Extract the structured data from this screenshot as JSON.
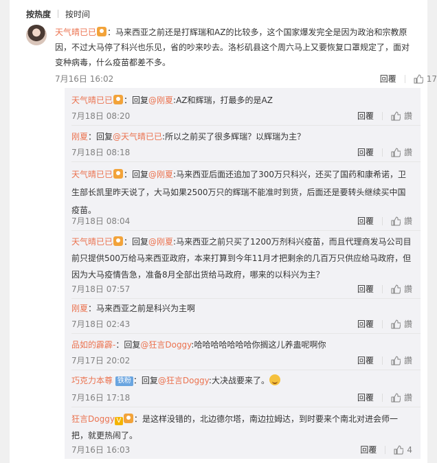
{
  "sort": {
    "hot": "按热度",
    "time": "按时间"
  },
  "main": {
    "user": "天气晴已已",
    "text": "：马来西亚之前还是打辉瑞和AZ的比较多，这个国家爆发完全是因为政治和宗教原因，不过大马停了科兴也乐见，省的吵来吵去。洛杉矶县这个周六马上又要恢复口罩规定了，面对变种病毒，什么疫苗都差不多。",
    "date": "7月16日 16:02",
    "reply": "回覆",
    "likes": "17"
  },
  "replies": [
    {
      "user": "天气晴已已",
      "badge": true,
      "prefix": "：回复",
      "mention": "@刚夏",
      "text": ":AZ和辉瑞，打最多的是AZ",
      "date": "7月18日 08:20",
      "reply": "回覆",
      "like": "讚"
    },
    {
      "user": "刚夏",
      "prefix": "：回复",
      "mention": "@天气晴已已",
      "text": ":所以之前买了很多辉瑞？以辉瑞为主？",
      "date": "7月18日 08:18",
      "reply": "回覆",
      "like": "讚"
    },
    {
      "user": "天气晴已已",
      "badge": true,
      "prefix": "：回复",
      "mention": "@刚夏",
      "text": ":马来西亚后面还追加了300万只科兴，还买了国药和康希诺，卫生部长凯里昨天说了，大马如果2500万只的辉瑞不能准时到货，后面还是要转头继续买中国疫苗。",
      "date": "7月18日 08:04",
      "reply": "回覆",
      "like": "讚"
    },
    {
      "user": "天气晴已已",
      "badge": true,
      "prefix": "：回复",
      "mention": "@刚夏",
      "text": ":马来西亚之前只买了1200万剂科兴疫苗，而且代理商发马公司目前只提供500万给马来西亚政府，本来打算到今年11月才把剩余的几百万只供应给马政府，但因为大马疫情告急，准备8月全部出货给马政府，哪来的以科兴为主？",
      "date": "7月18日 07:57",
      "reply": "回覆",
      "like": "讚"
    },
    {
      "user": "刚夏",
      "prefix": "：",
      "mention": "",
      "text": "马来西亚之前是科兴为主啊",
      "date": "7月18日 02:43",
      "reply": "回覆",
      "like": "讚"
    },
    {
      "user": "品如的霹霹-",
      "prefix": "：回复",
      "mention": "@狂言Doggy",
      "text": ":哈哈哈哈哈哈哈你搁这儿养蛊呢啊你",
      "date": "7月17日 20:02",
      "reply": "回覆",
      "like": "讚"
    },
    {
      "user": "巧克力本尊",
      "tag": "铁粉",
      "prefix": "：回复",
      "mention": "@狂言Doggy",
      "text": ":大决战要来了。",
      "emoji": true,
      "date": "7月16日 17:18",
      "reply": "回覆",
      "like": "讚"
    },
    {
      "user": "狂言Doggy",
      "vbadge": "V",
      "badge": true,
      "prefix": "：",
      "mention": "",
      "text": "是这样没错的，北边德尔塔，南边拉姆达，到时要来个南北对进会师一把，就更热闹了。",
      "date": "7月16日 16:03",
      "reply": "回覆",
      "like": "4"
    }
  ]
}
